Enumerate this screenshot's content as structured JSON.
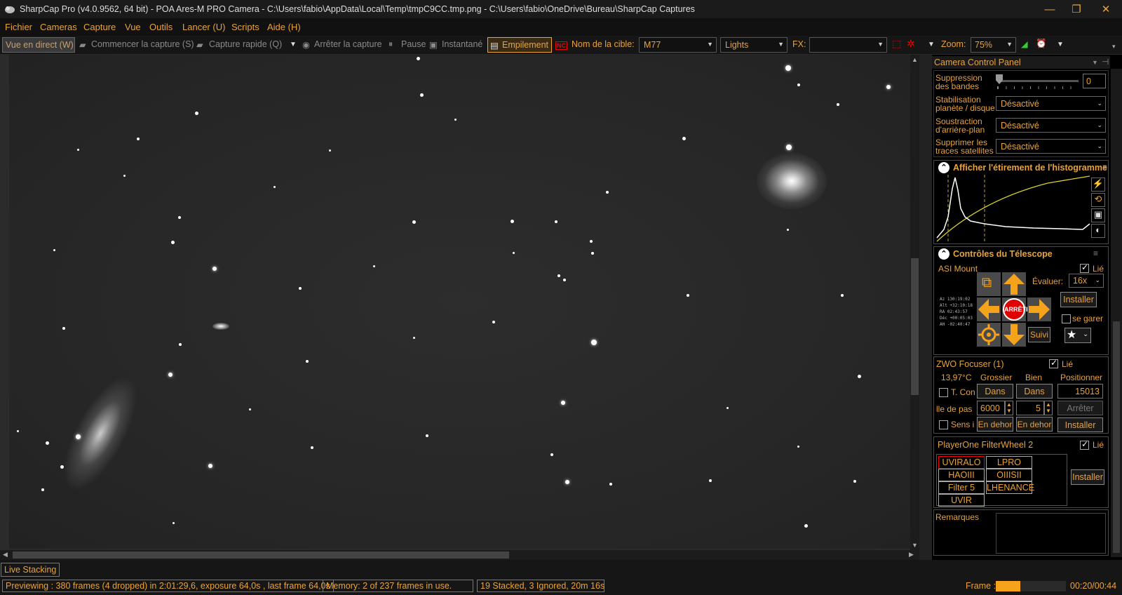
{
  "window": {
    "title": "SharpCap Pro (v4.0.9562, 64 bit) - POA Ares-M PRO Camera - C:\\Users\\fabio\\AppData\\Local\\Temp\\tmpC9CC.tmp.png - C:\\Users\\fabio\\OneDrive\\Bureau\\SharpCap Captures",
    "minimize": "—",
    "maximize": "❐",
    "close": "✕"
  },
  "menu": [
    "Fichier",
    "Cameras",
    "Capture",
    "Vue",
    "Outils",
    "Lancer (U)",
    "Scripts",
    "Aide (H)"
  ],
  "toolbar": {
    "live_view": "Vue en direct (W)",
    "start_capture": "Commencer la capture (S)",
    "quick_capture": "Capture rapide (Q)",
    "stop_capture": "Arrêter la capture",
    "pause": "Pause",
    "snapshot": "Instantané",
    "stacking": "Empilement",
    "nc_badge": "NC",
    "target_label": "Nom de la cible:",
    "target_value": "M77",
    "frame_type": "Lights",
    "fx_label": "FX:",
    "fx_value": "",
    "zoom_label": "Zoom:",
    "zoom_value": "75%"
  },
  "panel": {
    "title": "Camera Control Panel",
    "banding_label": "Suppression des bandes",
    "banding_value": "0",
    "stabilization_label": "Stabilisation planète / disque",
    "stabilization_value": "Désactivé",
    "background_label": "Soustraction d'arrière-plan",
    "background_value": "Désactivé",
    "satellite_label": "Supprimer les traces satellites",
    "satellite_value": "Désactivé",
    "histogram_title": "Afficher l'étirement de l'histogramme",
    "telescope_title": "Contrôles du Télescope",
    "mount_name": "ASI Mount",
    "linked": "Lié",
    "rate_label": "Évaluer:",
    "rate_value": "16x",
    "stop_label": "ARRÊTE",
    "install": "Installer",
    "park": "se garer",
    "tracking": "Suivi",
    "coords": [
      "Az 130:19:02",
      "Alt +32:10:18",
      "RA 02:43:57",
      "Déc +00:05:03",
      "AH -02:40:47"
    ],
    "focuser_name": "ZWO Focuser (1)",
    "temperature": "13,97°C",
    "coarse": "Grossier",
    "fine": "Bien",
    "position_label": "Positionner",
    "temp_comp": "T. Con",
    "in_label": "Dans",
    "position_value": "15013",
    "step_label": "lle de pas",
    "coarse_step": "6000",
    "fine_step": "5",
    "stop": "Arrêter",
    "reverse": "Sens i",
    "out_label": "En dehor",
    "filterwheel_name": "PlayerOne FilterWheel 2",
    "filters": [
      "UVIRALO",
      "LPRO",
      "HAOIII",
      "OIIISII",
      "Filter 5",
      "LHENANCE",
      "UVIR"
    ],
    "notes_label": "Remarques"
  },
  "status": {
    "mode": "Live Stacking",
    "preview": "Previewing : 380 frames (4 dropped) in 2:01:29,6, exposure 64,0s , last frame 64,0s",
    "memory": "Memory: 2 of 237 frames in use.",
    "stacked": "19 Stacked, 3 Ignored, 20m 16s",
    "frame_label": "Frame :",
    "frame_progress": 0.35,
    "timer": "00:20/00:44"
  },
  "colors": {
    "accent": "#e8a33c",
    "arrow": "#f5a31a",
    "stop_red": "#e00000"
  }
}
